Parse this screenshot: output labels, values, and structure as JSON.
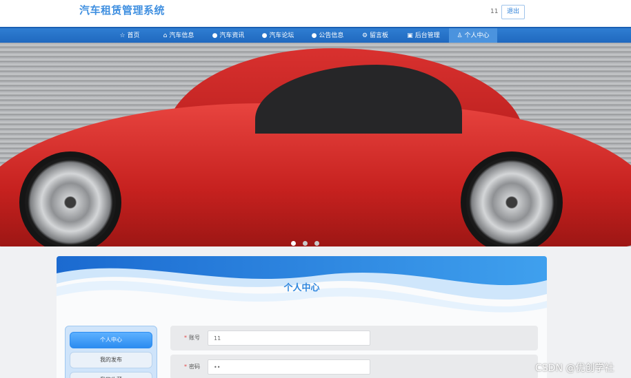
{
  "header": {
    "title": "汽车租赁管理系统",
    "username": "11",
    "logout_label": "退出"
  },
  "nav": [
    {
      "label": "首页",
      "icon": "star-icon"
    },
    {
      "label": "汽车信息",
      "icon": "bag-icon"
    },
    {
      "label": "汽车资讯",
      "icon": "info-icon"
    },
    {
      "label": "汽车论坛",
      "icon": "info-icon"
    },
    {
      "label": "公告信息",
      "icon": "info-icon"
    },
    {
      "label": "留言板",
      "icon": "settings-icon"
    },
    {
      "label": "后台管理",
      "icon": "folder-icon"
    },
    {
      "label": "个人中心",
      "icon": "user-icon",
      "active": true
    }
  ],
  "panel": {
    "title": "个人中心"
  },
  "side_menu": [
    {
      "label": "个人中心",
      "active": true
    },
    {
      "label": "我的发布"
    },
    {
      "label": "我的收藏"
    }
  ],
  "form": [
    {
      "label": "账号",
      "value": "11"
    },
    {
      "label": "密码",
      "value": "••"
    }
  ],
  "watermark": "CSDN @优创学社",
  "colors": {
    "brand": "#2e86de",
    "nav": "#1e66bd",
    "car": "#c6211f"
  }
}
